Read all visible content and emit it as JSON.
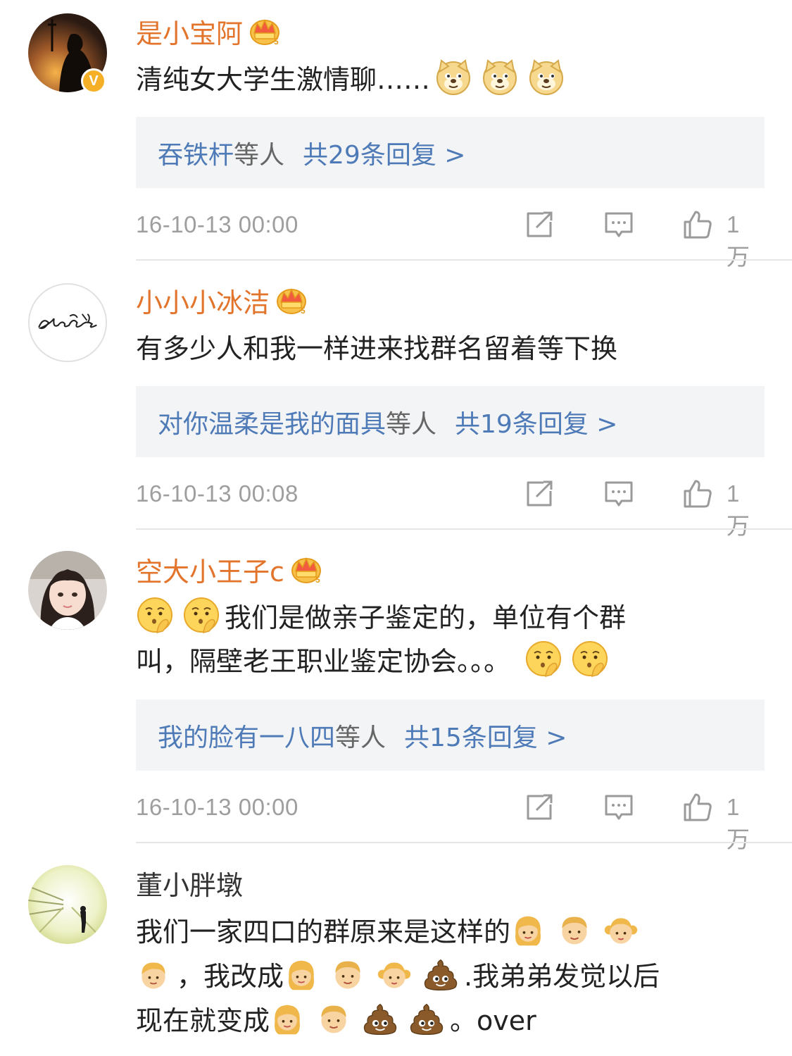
{
  "comments": [
    {
      "username": "是小宝阿",
      "has_crown": true,
      "verified": "V",
      "text": "清纯女大学生激情聊……",
      "emojis_after": [
        "doge-emoji",
        "doge-emoji",
        "doge-emoji"
      ],
      "replies": {
        "names": "吞铁杆",
        "etc": "等人",
        "count": "共29条回复 >"
      },
      "time": "16-10-13 00:00",
      "likes": "1万"
    },
    {
      "username": "小小小冰洁",
      "has_crown": true,
      "text": "有多少人和我一样进来找群名留着等下换",
      "replies": {
        "names": "对你温柔是我的面具",
        "etc": "等人",
        "count": "共19条回复 >"
      },
      "time": "16-10-13 00:08",
      "likes": "1万"
    },
    {
      "username": "空大小王子c",
      "has_crown": true,
      "text_line1": "我们是做亲子鉴定的，单位有个群",
      "text_line2": "叫，隔壁老王职业鉴定协会。。。",
      "replies": {
        "names": "我的脸有一八四",
        "etc": "等人",
        "count": "共15条回复 >"
      },
      "time": "16-10-13 00:00",
      "likes": "1万"
    },
    {
      "username": "董小胖墩",
      "has_crown": false,
      "text_part1": "我们一家四口的群原来是这样的",
      "text_part2": "，我改成",
      "text_part3": ".我弟弟发觉以后",
      "text_part4": "现在就变成",
      "text_part5": "。over"
    }
  ],
  "colors": {
    "username": "#e2742b",
    "link": "#4e7bb7",
    "meta": "#9e9e9e",
    "reply_bg": "#f3f4f6",
    "verified_badge": "#f5b027"
  },
  "icons": [
    "repost-icon",
    "comment-icon",
    "thumbs-up-icon",
    "crown-icon"
  ]
}
